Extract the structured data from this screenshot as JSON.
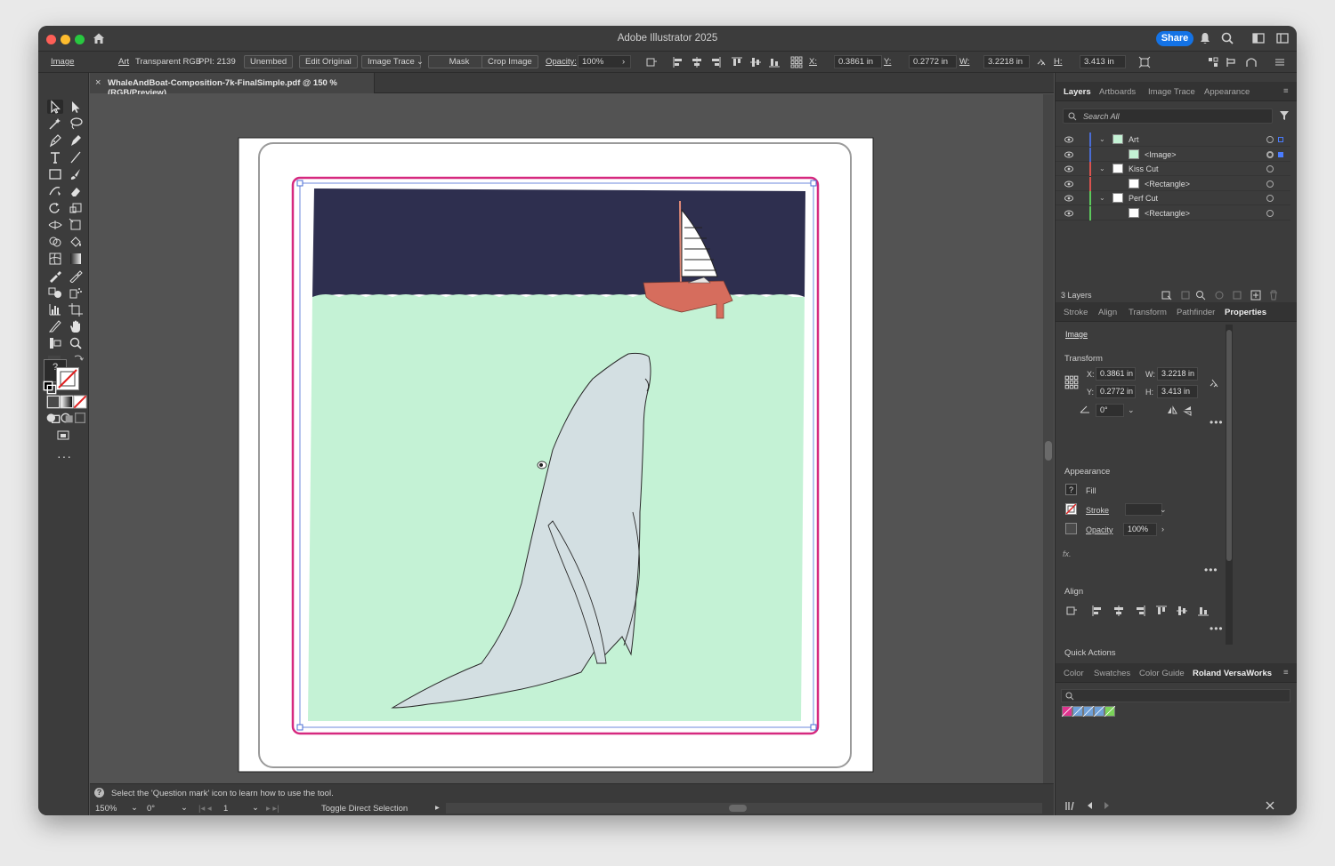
{
  "app": {
    "title": "Adobe Illustrator 2025",
    "share_label": "Share"
  },
  "controlbar": {
    "selection_label": "Image",
    "art": "Art",
    "color_mode": "Transparent RGB",
    "ppi": "PPI: 2139",
    "unembed": "Unembed",
    "edit_original": "Edit Original",
    "image_trace": "Image Trace",
    "mask": "Mask",
    "crop_image": "Crop Image",
    "opacity_label": "Opacity:",
    "opacity_value": "100%",
    "x_label": "X:",
    "x_value": "0.3861 in",
    "y_label": "Y:",
    "y_value": "0.2772 in",
    "w_label": "W:",
    "w_value": "3.2218 in",
    "h_label": "H:",
    "h_value": "3.413 in"
  },
  "document": {
    "tab_name": "WhaleAndBoat-Composition-7k-FinalSimple.pdf @ 150 % (RGB/Preview)",
    "close": "×"
  },
  "status": {
    "hint": "Select the 'Question mark' icon to learn how to use the tool.",
    "zoom": "150%",
    "rotation": "0°",
    "artboard": "1",
    "tool_status": "Toggle Direct Selection"
  },
  "layers_panel": {
    "tabs": [
      "Layers",
      "Artboards",
      "Image Trace",
      "Appearance"
    ],
    "search_placeholder": "Search All",
    "rows": [
      {
        "name": "Art",
        "color": "#4a6cd4"
      },
      {
        "name": "<Image>",
        "color": "#4a6cd4"
      },
      {
        "name": "Kiss Cut",
        "color": "#d9534f"
      },
      {
        "name": "<Rectangle>",
        "color": "#d9534f"
      },
      {
        "name": "Perf Cut",
        "color": "#5cc85c"
      },
      {
        "name": "<Rectangle>",
        "color": "#5cc85c"
      }
    ],
    "count": "3 Layers"
  },
  "properties_panel": {
    "tabs": [
      "Stroke",
      "Align",
      "Transform",
      "Pathfinder",
      "Properties"
    ],
    "selection": "Image",
    "transform_title": "Transform",
    "x_label": "X:",
    "x_value": "0.3861 in",
    "y_label": "Y:",
    "y_value": "0.2772 in",
    "w_label": "W:",
    "w_value": "3.2218 in",
    "h_label": "H:",
    "h_value": "3.413 in",
    "angle_value": "0°",
    "appearance_title": "Appearance",
    "fill_label": "Fill",
    "stroke_label": "Stroke",
    "opacity_label": "Opacity",
    "opacity_value": "100%",
    "fx": "fx.",
    "align_title": "Align",
    "quick_actions_title": "Quick Actions"
  },
  "swatches_panel": {
    "tabs": [
      "Color",
      "Swatches",
      "Color Guide",
      "Roland VersaWorks"
    ],
    "swatch_colors": [
      "#e0338f",
      "#6fa0d8",
      "#6fa0d8",
      "#6fa0d8",
      "#7bd35a"
    ]
  },
  "colors": {
    "kiss_cut": "#d6297f",
    "sky": "#2e2f4f",
    "water": "#c4f2d5",
    "whale": "#d3dfe2",
    "boat": "#d66d5d"
  }
}
